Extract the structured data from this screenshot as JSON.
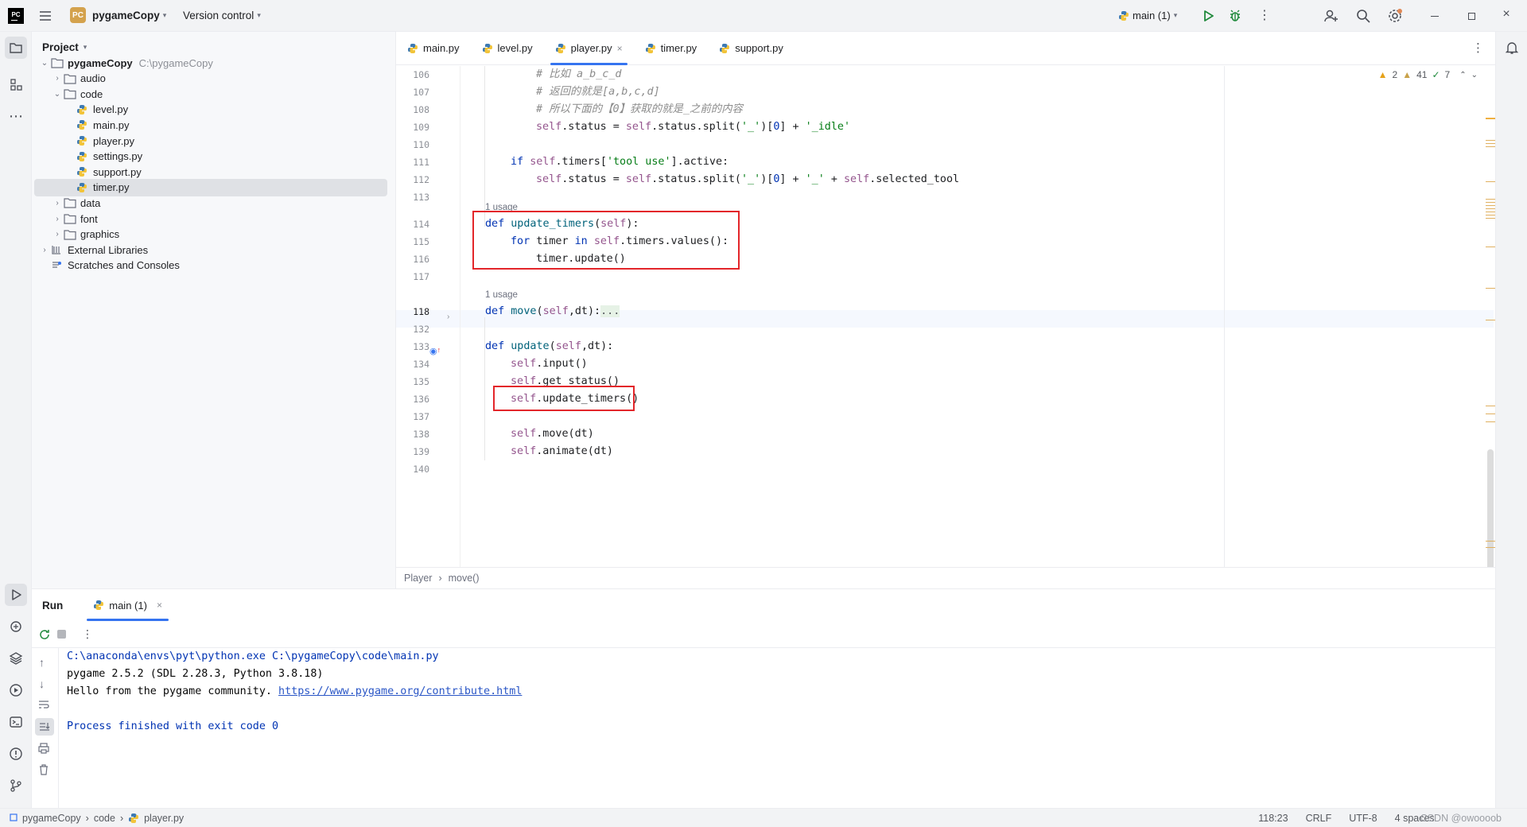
{
  "titlebar": {
    "project_badge": "PC",
    "project_name": "pygameCopy",
    "vcs": "Version control",
    "run_config": "main (1)"
  },
  "project_panel": {
    "title": "Project",
    "tree": [
      {
        "label": "pygameCopy",
        "path": "C:\\pygameCopy",
        "type": "root"
      },
      {
        "label": "audio",
        "type": "folder"
      },
      {
        "label": "code",
        "type": "folder-open"
      },
      {
        "label": "level.py",
        "type": "py"
      },
      {
        "label": "main.py",
        "type": "py"
      },
      {
        "label": "player.py",
        "type": "py"
      },
      {
        "label": "settings.py",
        "type": "py"
      },
      {
        "label": "support.py",
        "type": "py"
      },
      {
        "label": "timer.py",
        "type": "py",
        "selected": true
      },
      {
        "label": "data",
        "type": "folder"
      },
      {
        "label": "font",
        "type": "folder"
      },
      {
        "label": "graphics",
        "type": "folder"
      },
      {
        "label": "External Libraries",
        "type": "lib"
      },
      {
        "label": "Scratches and Consoles",
        "type": "scratch"
      }
    ]
  },
  "tabs": [
    {
      "label": "main.py"
    },
    {
      "label": "level.py"
    },
    {
      "label": "player.py",
      "active": true
    },
    {
      "label": "timer.py"
    },
    {
      "label": "support.py"
    }
  ],
  "inspections": {
    "warn_strong": "2",
    "warn_weak": "41",
    "ok": "7"
  },
  "code": {
    "line_numbers": [
      "106",
      "107",
      "108",
      "109",
      "110",
      "111",
      "112",
      "113",
      "114",
      "115",
      "116",
      "117",
      "118",
      "132",
      "133",
      "134",
      "135",
      "136",
      "137",
      "138",
      "139",
      "140"
    ],
    "hints": {
      "usage1": "1 usage",
      "usage2": "1 usage"
    },
    "lines": {
      "l106": "# 比如 a_b_c_d",
      "l107": "# 返回的就是[a,b,c,d]",
      "l108": "# 所以下面的【0】获取的就是_之前的内容",
      "l109a": "self",
      "l109b": ".status = ",
      "l109c": "self",
      "l109d": ".status.split(",
      "l109e": "'_'",
      "l109f": ")[",
      "l109g": "0",
      "l109h": "] + ",
      "l109i": "'_idle'",
      "l111a": "if ",
      "l111b": "self",
      "l111c": ".timers[",
      "l111d": "'tool use'",
      "l111e": "].active:",
      "l112a": "self",
      "l112b": ".status = ",
      "l112c": "self",
      "l112d": ".status.split(",
      "l112e": "'_'",
      "l112f": ")[",
      "l112g": "0",
      "l112h": "] + ",
      "l112i": "'_'",
      "l112j": " + ",
      "l112k": "self",
      "l112l": ".selected_tool",
      "l114a": "def ",
      "l114b": "update_timers",
      "l114c": "(",
      "l114d": "self",
      "l114e": "):",
      "l115a": "for ",
      "l115b": "timer ",
      "l115c": "in ",
      "l115d": "self",
      "l115e": ".timers.values():",
      "l116": "timer.update()",
      "l118a": "def ",
      "l118b": "move",
      "l118c": "(",
      "l118d": "self",
      "l118e": ",dt):",
      "l118f": "...",
      "l133a": "def ",
      "l133b": "update",
      "l133c": "(",
      "l133d": "self",
      "l133e": ",dt):",
      "l134a": "self",
      "l134b": ".input()",
      "l135a": "self",
      "l135b": ".get_status()",
      "l136a": "self",
      "l136b": ".update_timers()",
      "l138a": "self",
      "l138b": ".move(dt)",
      "l139a": "self",
      "l139b": ".animate(dt)"
    }
  },
  "breadcrumb": {
    "class": "Player",
    "method": "move()"
  },
  "run_panel": {
    "title": "Run",
    "tab": "main (1)",
    "console": {
      "line1": "C:\\anaconda\\envs\\pyt\\python.exe C:\\pygameCopy\\code\\main.py",
      "line2": "pygame 2.5.2 (SDL 2.28.3, Python 3.8.18)",
      "line3_text": "Hello from the pygame community. ",
      "line3_link": "https://www.pygame.org/contribute.html",
      "line5": "Process finished with exit code 0"
    }
  },
  "statusbar": {
    "path": [
      "pygameCopy",
      "code",
      "player.py"
    ],
    "position": "118:23",
    "line_sep": "CRLF",
    "encoding": "UTF-8",
    "indent": "4 spaces",
    "watermark": "CSDN @owoooob"
  },
  "colors": {
    "accent": "#3574f0",
    "highlight_box": "#e3262a",
    "selected_row": "#dfe1e5"
  }
}
